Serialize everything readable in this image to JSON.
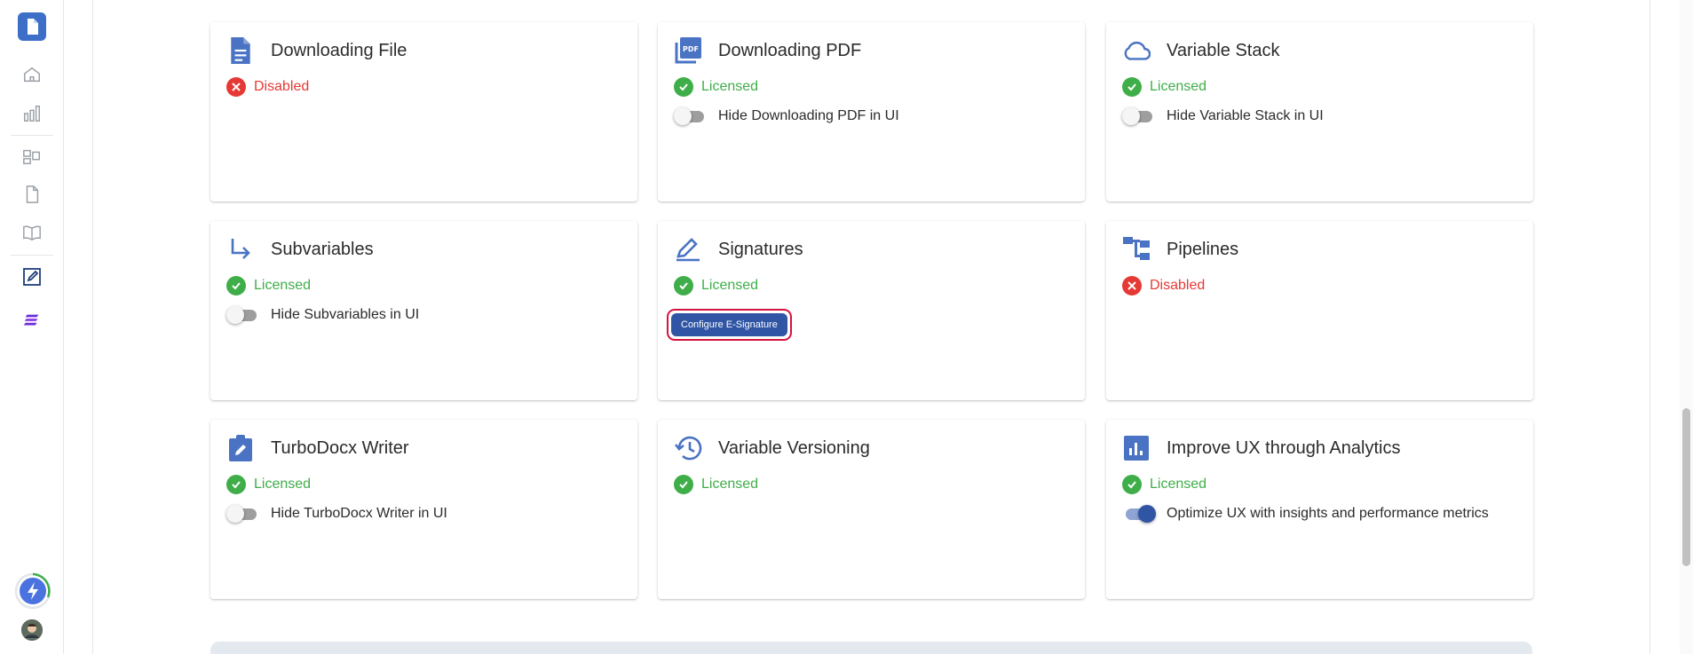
{
  "colors": {
    "accent": "#2f55a4",
    "licensed": "#3fae49",
    "disabled": "#e53935",
    "icon": "#4a73c4"
  },
  "rail": {
    "items": [
      {
        "name": "app-logo-icon"
      },
      {
        "name": "home-icon"
      },
      {
        "name": "bar-chart-icon"
      },
      {
        "name": "layout-icon"
      },
      {
        "name": "file-icon"
      },
      {
        "name": "book-icon"
      },
      {
        "name": "edit-document-icon"
      },
      {
        "name": "stacked-lines-icon"
      },
      {
        "name": "lightning-icon"
      },
      {
        "name": "avatar"
      }
    ]
  },
  "cards": [
    {
      "title": "Downloading File",
      "icon": "file-document-icon",
      "status": "Disabled",
      "state": "bad",
      "toggle": null
    },
    {
      "title": "Downloading PDF",
      "icon": "pdf-icon",
      "status": "Licensed",
      "state": "ok",
      "toggle": {
        "label": "Hide Downloading PDF in UI",
        "on": false
      }
    },
    {
      "title": "Variable Stack",
      "icon": "cloud-icon",
      "status": "Licensed",
      "state": "ok",
      "toggle": {
        "label": "Hide Variable Stack in UI",
        "on": false
      }
    },
    {
      "title": "Subvariables",
      "icon": "subdirectory-arrow-icon",
      "status": "Licensed",
      "state": "ok",
      "toggle": {
        "label": "Hide Subvariables in UI",
        "on": false
      }
    },
    {
      "title": "Signatures",
      "icon": "signature-pen-icon",
      "status": "Licensed",
      "state": "ok",
      "button": "Configure E-Signature"
    },
    {
      "title": "Pipelines",
      "icon": "pipeline-icon",
      "status": "Disabled",
      "state": "bad",
      "toggle": null
    },
    {
      "title": "TurboDocx Writer",
      "icon": "clipboard-edit-icon",
      "status": "Licensed",
      "state": "ok",
      "toggle": {
        "label": "Hide TurboDocx Writer in UI",
        "on": false
      }
    },
    {
      "title": "Variable Versioning",
      "icon": "history-icon",
      "status": "Licensed",
      "state": "ok",
      "toggle": null
    },
    {
      "title": "Improve UX through Analytics",
      "icon": "analytics-icon",
      "status": "Licensed",
      "state": "ok",
      "toggle": {
        "label": "Optimize UX with insights and performance metrics",
        "on": true
      }
    }
  ]
}
